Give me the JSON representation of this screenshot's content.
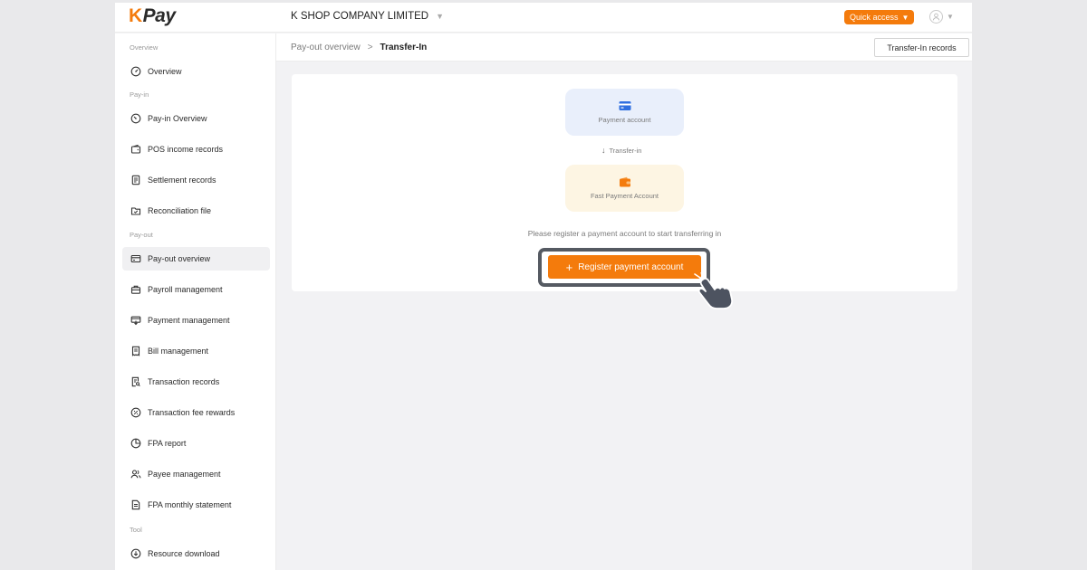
{
  "brand": {
    "logo_k": "K",
    "logo_rest": "Pay"
  },
  "header": {
    "company": "K SHOP COMPANY LIMITED",
    "quick_access": "Quick access"
  },
  "sidebar": {
    "sections": {
      "overview": "Overview",
      "payin": "Pay-in",
      "payout": "Pay-out",
      "tool": "Tool"
    },
    "items": {
      "overview": "Overview",
      "payin_overview": "Pay-in Overview",
      "pos_income": "POS income records",
      "settlement": "Settlement records",
      "reconciliation": "Reconciliation file",
      "payout_overview": "Pay-out overview",
      "payroll": "Payroll management",
      "payment": "Payment management",
      "bill": "Bill management",
      "transaction": "Transaction records",
      "fee_rewards": "Transaction fee rewards",
      "fpa_report": "FPA report",
      "payee": "Payee management",
      "fpa_statement": "FPA monthly statement",
      "resource": "Resource download"
    },
    "active": "payout_overview"
  },
  "breadcrumb": {
    "parent": "Pay-out overview",
    "separator": ">",
    "current": "Transfer-In"
  },
  "toolbar": {
    "records_button": "Transfer-In records"
  },
  "content": {
    "payment_account": "Payment account",
    "transfer_label": "Transfer-in",
    "fast_payment_account": "Fast Payment Account",
    "hint": "Please register a payment account to start transferring in",
    "register_button": "Register payment account"
  },
  "colors": {
    "accent": "#f47b0c",
    "payment_account_bg": "#e9effb",
    "fast_account_bg": "#fdf5e3",
    "card_icon": "#2f6fe0",
    "wallet_icon": "#f47b0c",
    "highlight_frame": "#555a62"
  },
  "icons": {
    "card": "credit-card-icon",
    "wallet": "wallet-icon",
    "pointer": "pointing-hand-icon"
  }
}
